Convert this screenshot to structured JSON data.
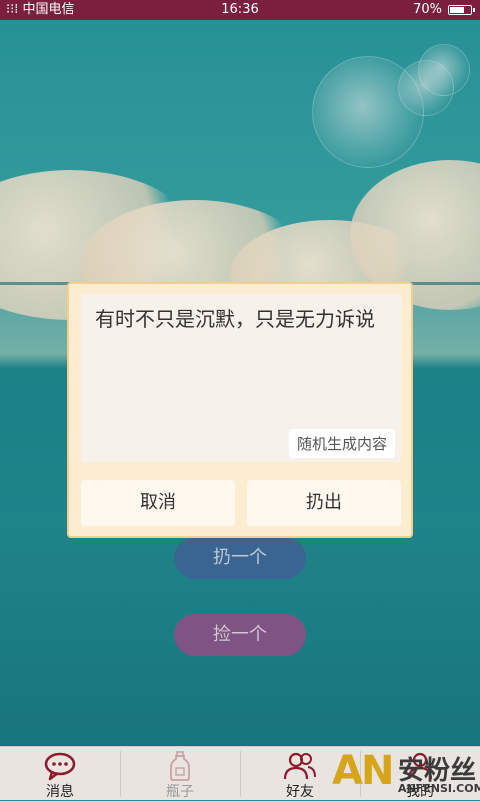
{
  "status_bar": {
    "carrier": "中国电信",
    "time": "16:36",
    "battery": "70%",
    "battery_level": 0.7
  },
  "background_buttons": {
    "throw_one": "扔一个",
    "pick_one": "捡一个"
  },
  "dialog": {
    "message": "有时不只是沉默，只是无力诉说",
    "random_button": "随机生成内容",
    "cancel": "取消",
    "throw": "扔出"
  },
  "tabs": [
    {
      "label": "消息",
      "icon": "chat-bubble-icon",
      "active": true
    },
    {
      "label": "瓶子",
      "icon": "bottle-icon",
      "active": false
    },
    {
      "label": "好友",
      "icon": "friends-icon",
      "active": false
    },
    {
      "label": "我的",
      "icon": "profile-icon",
      "active": false
    }
  ],
  "watermark": {
    "logo": "AN",
    "text": "安粉丝",
    "url": "ANFENSI.COM"
  },
  "colors": {
    "status_bar": "#7a1f3d",
    "accent": "#8b1a2b",
    "dialog_bg": "#fdedd0",
    "tab_inactive": "#999999"
  }
}
